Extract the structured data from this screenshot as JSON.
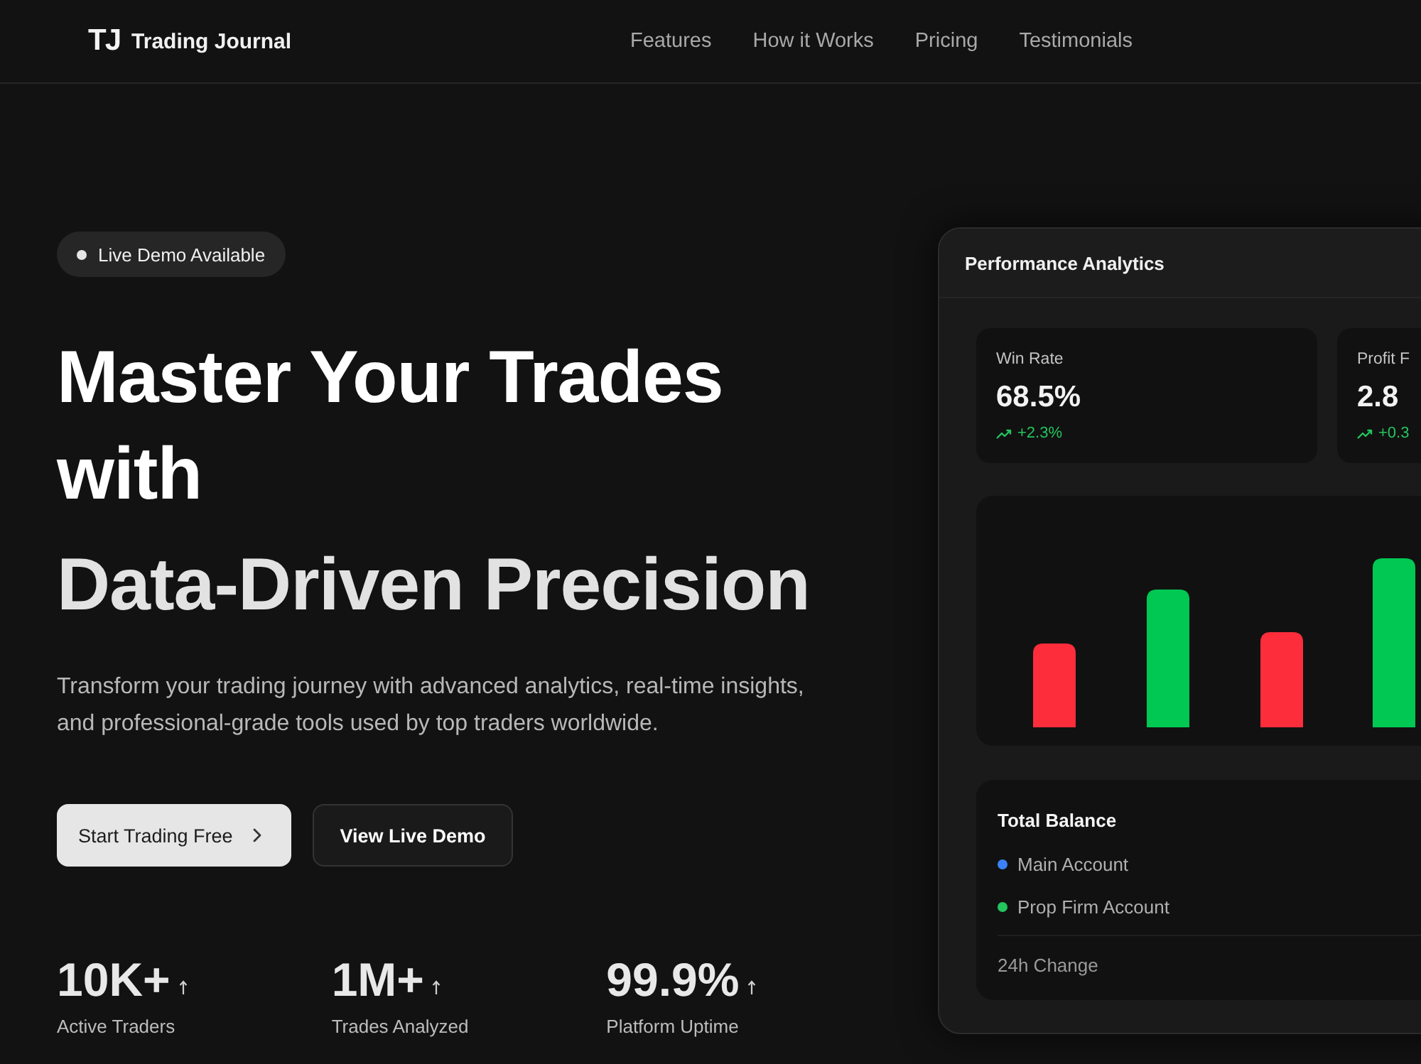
{
  "header": {
    "logo_mark": "TJ",
    "brand": "Trading Journal",
    "nav": [
      "Features",
      "How it Works",
      "Pricing",
      "Testimonials"
    ]
  },
  "hero": {
    "badge": "Live Demo Available",
    "title": "Master Your Trades with",
    "title_accent": "Data-Driven Precision",
    "description": "Transform your trading journey with advanced analytics, real-time insights, and professional-grade tools used by top traders worldwide.",
    "buttons": [
      {
        "label": "Start Trading Free",
        "kind": "primary"
      },
      {
        "label": "View Live Demo",
        "kind": "secondary"
      }
    ],
    "stats": [
      {
        "value": "10K+",
        "label": "Active Traders"
      },
      {
        "value": "1M+",
        "label": "Trades Analyzed"
      },
      {
        "value": "99.9%",
        "label": "Platform Uptime"
      }
    ]
  },
  "analytics_panel": {
    "title": "Performance Analytics",
    "metrics": [
      {
        "label": "Win Rate",
        "value": "68.5%",
        "change": "+2.3%"
      },
      {
        "label": "Profit F",
        "value": "2.8",
        "change": "+0.3"
      }
    ],
    "balance": {
      "title": "Total Balance",
      "accounts": [
        {
          "name": "Main Account",
          "color": "#3b82f6"
        },
        {
          "name": "Prop Firm Account",
          "color": "#22c55e"
        }
      ],
      "change_label": "24h Change"
    }
  }
}
